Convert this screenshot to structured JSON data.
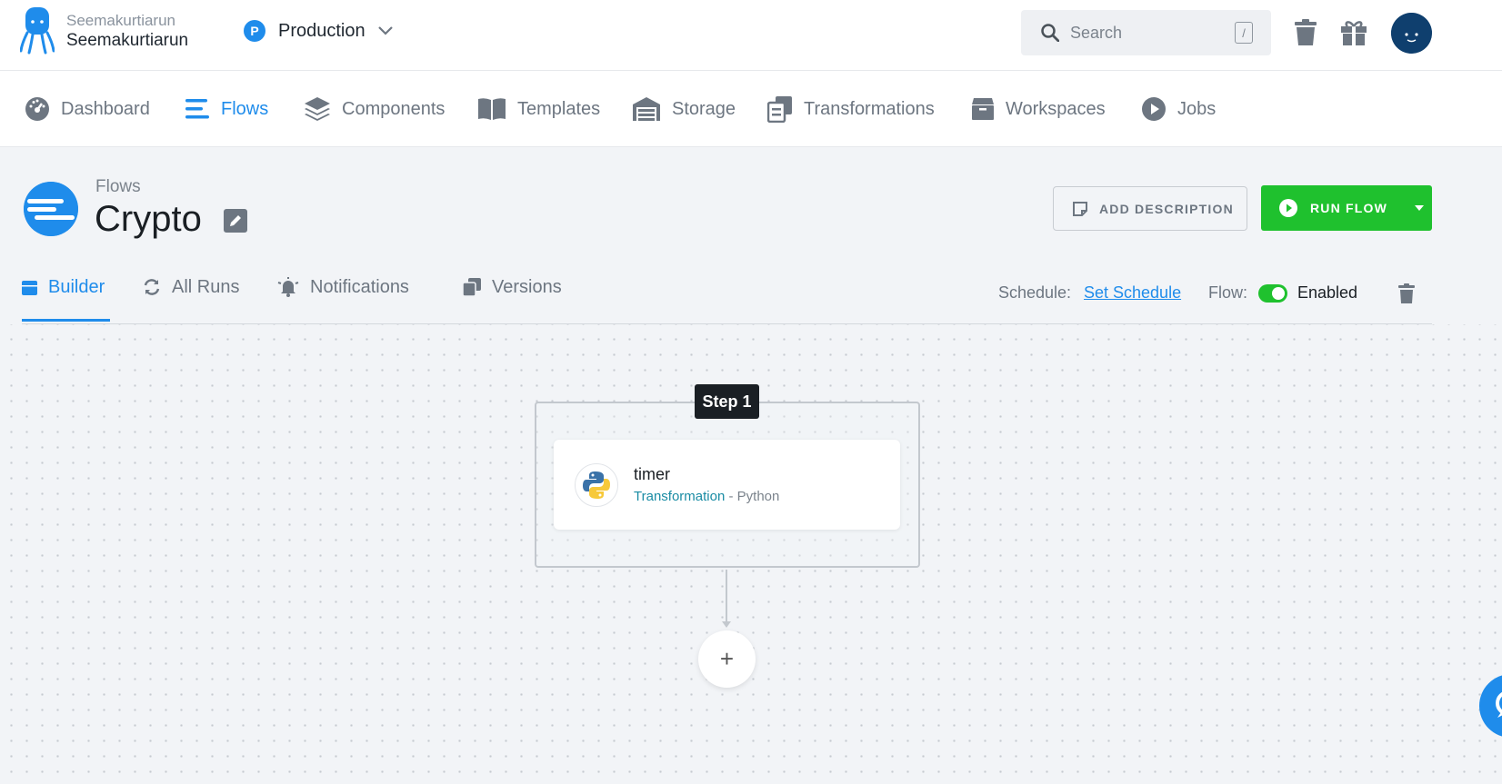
{
  "header": {
    "org_sub": "Seemakurtiarun",
    "org_main": "Seemakurtiarun",
    "project_badge": "P",
    "project_name": "Production",
    "search_placeholder": "Search",
    "search_shortcut": "/"
  },
  "nav": {
    "items": [
      {
        "label": "Dashboard",
        "icon": "dashboard-gauge-icon"
      },
      {
        "label": "Flows",
        "icon": "flows-icon",
        "active": true
      },
      {
        "label": "Components",
        "icon": "layers-icon"
      },
      {
        "label": "Templates",
        "icon": "book-icon"
      },
      {
        "label": "Storage",
        "icon": "warehouse-icon"
      },
      {
        "label": "Transformations",
        "icon": "copy-icon"
      },
      {
        "label": "Workspaces",
        "icon": "box-icon"
      },
      {
        "label": "Jobs",
        "icon": "play-circle-icon"
      }
    ]
  },
  "page": {
    "breadcrumb": "Flows",
    "title": "Crypto",
    "add_description": "ADD DESCRIPTION",
    "run_flow": "RUN FLOW"
  },
  "tabs": [
    {
      "label": "Builder",
      "active": true
    },
    {
      "label": "All Runs"
    },
    {
      "label": "Notifications"
    },
    {
      "label": "Versions"
    }
  ],
  "schedule": {
    "label": "Schedule:",
    "link": "Set Schedule",
    "flow_label": "Flow:",
    "flow_state": "Enabled",
    "enabled": true
  },
  "builder": {
    "step_label": "Step 1",
    "task": {
      "name": "timer",
      "type": "Transformation",
      "separator": " - ",
      "component": "Python"
    },
    "add_symbol": "+"
  },
  "colors": {
    "accent": "#1f8ceb",
    "success": "#1fc12e",
    "link_teal": "#1a8ca4"
  }
}
